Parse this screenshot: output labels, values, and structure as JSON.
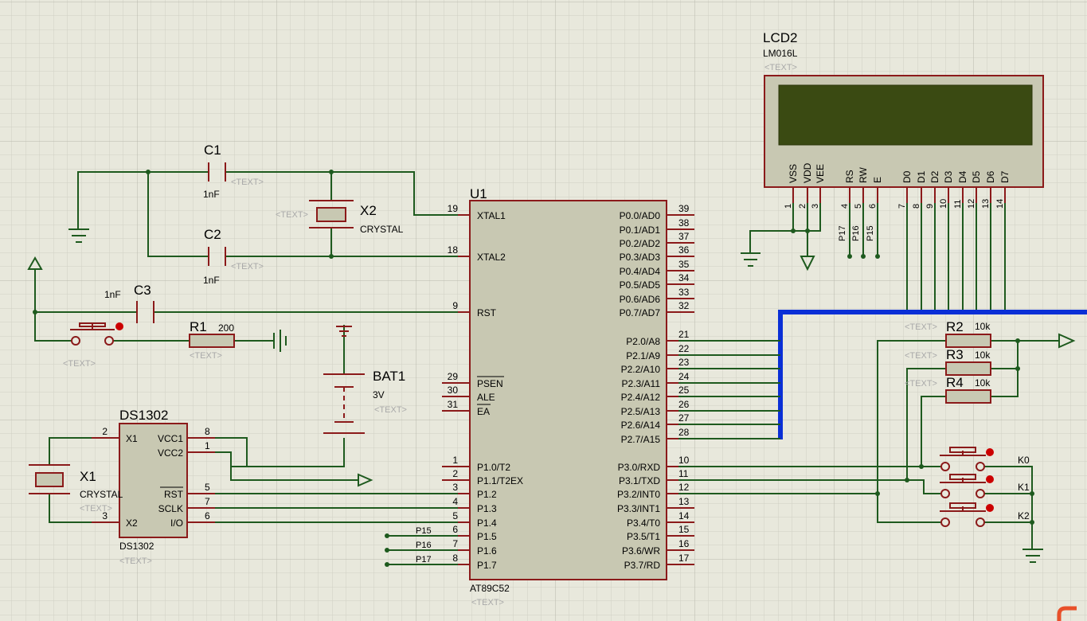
{
  "colors": {
    "background": "#e8e8dc",
    "grid_minor": "#d0d0c4",
    "grid_major": "#bcbcb0",
    "wire": "#1e5a1e",
    "part": "#8b1a1a",
    "body": "#c8c8b2",
    "bus": "#0a2fd6",
    "lcd_screen": "#3a4a12"
  },
  "components": {
    "lcd": {
      "ref": "LCD2",
      "model": "LM016L",
      "text": "<TEXT>",
      "pins": [
        "VSS",
        "VDD",
        "VEE",
        "RS",
        "RW",
        "E",
        "D0",
        "D1",
        "D2",
        "D3",
        "D4",
        "D5",
        "D6",
        "D7"
      ],
      "pin_numbers": [
        "1",
        "2",
        "3",
        "4",
        "5",
        "6",
        "7",
        "8",
        "9",
        "10",
        "11",
        "12",
        "13",
        "14"
      ]
    },
    "c1": {
      "ref": "C1",
      "value": "1nF",
      "text": "<TEXT>"
    },
    "c2": {
      "ref": "C2",
      "value": "1nF",
      "text": "<TEXT>"
    },
    "c3": {
      "ref": "C3",
      "value": "1nF"
    },
    "x2": {
      "ref": "X2",
      "value": "CRYSTAL",
      "text": "<TEXT>"
    },
    "x1": {
      "ref": "X1",
      "value": "CRYSTAL",
      "text": "<TEXT>"
    },
    "r1": {
      "ref": "R1",
      "value": "200",
      "text": "<TEXT>"
    },
    "r2": {
      "ref": "R2",
      "value": "10k",
      "text": "<TEXT>"
    },
    "r3": {
      "ref": "R3",
      "value": "10k",
      "text": "<TEXT>"
    },
    "r4": {
      "ref": "R4",
      "value": "10k",
      "text": "<TEXT>"
    },
    "bat": {
      "ref": "BAT1",
      "value": "3V",
      "text": "<TEXT>"
    },
    "reset_button": {
      "text": "<TEXT>"
    },
    "u1": {
      "ref": "U1",
      "model": "AT89C52",
      "text": "<TEXT>",
      "left_pins": [
        [
          "19",
          "XTAL1"
        ],
        [
          "18",
          "XTAL2"
        ],
        [
          "9",
          "RST"
        ],
        [
          "29",
          "PSEN"
        ],
        [
          "30",
          "ALE"
        ],
        [
          "31",
          "EA"
        ],
        [
          "1",
          "P1.0/T2"
        ],
        [
          "2",
          "P1.1/T2EX"
        ],
        [
          "3",
          "P1.2"
        ],
        [
          "4",
          "P1.3"
        ],
        [
          "5",
          "P1.4"
        ],
        [
          "6",
          "P1.5"
        ],
        [
          "7",
          "P1.6"
        ],
        [
          "8",
          "P1.7"
        ]
      ],
      "right_pins": [
        [
          "39",
          "P0.0/AD0"
        ],
        [
          "38",
          "P0.1/AD1"
        ],
        [
          "37",
          "P0.2/AD2"
        ],
        [
          "36",
          "P0.3/AD3"
        ],
        [
          "35",
          "P0.4/AD4"
        ],
        [
          "34",
          "P0.5/AD5"
        ],
        [
          "33",
          "P0.6/AD6"
        ],
        [
          "32",
          "P0.7/AD7"
        ],
        [
          "21",
          "P2.0/A8"
        ],
        [
          "22",
          "P2.1/A9"
        ],
        [
          "23",
          "P2.2/A10"
        ],
        [
          "24",
          "P2.3/A11"
        ],
        [
          "25",
          "P2.4/A12"
        ],
        [
          "26",
          "P2.5/A13"
        ],
        [
          "27",
          "P2.6/A14"
        ],
        [
          "28",
          "P2.7/A15"
        ],
        [
          "10",
          "P3.0/RXD"
        ],
        [
          "11",
          "P3.1/TXD"
        ],
        [
          "12",
          "P3.2/INT0"
        ],
        [
          "13",
          "P3.3/INT1"
        ],
        [
          "14",
          "P3.4/T0"
        ],
        [
          "15",
          "P3.5/T1"
        ],
        [
          "16",
          "P3.6/WR"
        ],
        [
          "17",
          "P3.7/RD"
        ]
      ]
    },
    "ds1302": {
      "ref": "DS1302",
      "model": "DS1302",
      "text": "<TEXT>",
      "left_pins": [
        [
          "2",
          "X1"
        ],
        [
          "3",
          "X2"
        ]
      ],
      "right_pins": [
        [
          "8",
          "VCC1"
        ],
        [
          "1",
          "VCC2"
        ],
        [
          "5",
          "RST"
        ],
        [
          "7",
          "SCLK"
        ],
        [
          "6",
          "I/O"
        ]
      ]
    },
    "net_labels": {
      "p15": "P15",
      "p16": "P16",
      "p17": "P17"
    },
    "keys": [
      "K0",
      "K1",
      "K2"
    ]
  }
}
